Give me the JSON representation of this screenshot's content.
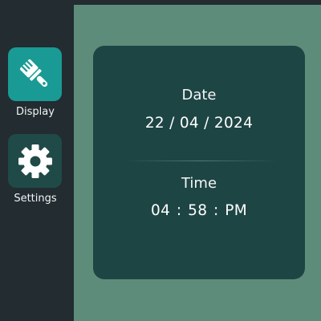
{
  "sidebar": {
    "items": [
      {
        "label": "Display",
        "icon": "paintbrush-icon",
        "active": true
      },
      {
        "label": "Settings",
        "icon": "gear-icon",
        "active": false
      }
    ]
  },
  "card": {
    "date_label": "Date",
    "date_value": "22 / 04 / 2024",
    "time_label": "Time",
    "time_hour": "04",
    "time_minute": "58",
    "time_period": "PM",
    "time_separator": ":"
  },
  "colors": {
    "sidebar_bg": "#222c31",
    "main_bg": "#5e8c7b",
    "card_bg": "#1d4544",
    "active_tile": "#1a9a94",
    "inactive_tile": "#1f4a47"
  }
}
